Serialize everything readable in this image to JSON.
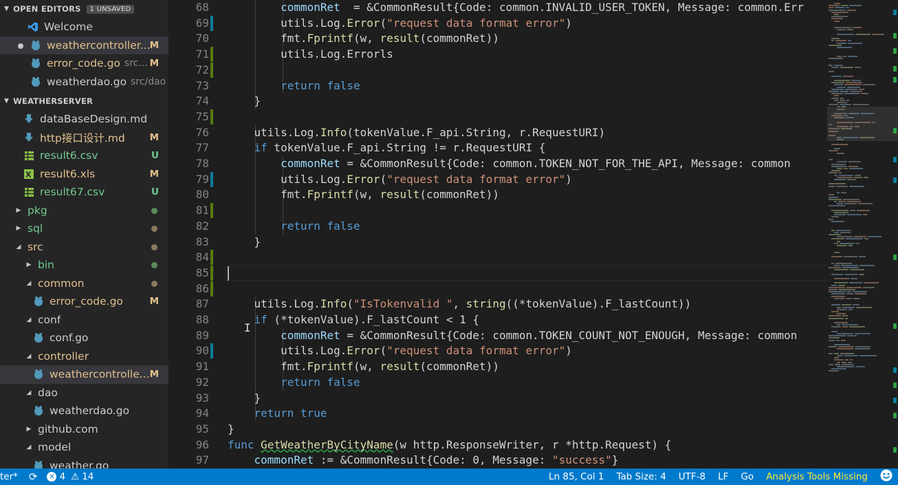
{
  "sidebar": {
    "open_editors": {
      "title": "OPEN EDITORS",
      "badge": "1 UNSAVED",
      "items": [
        {
          "name": "Welcome",
          "hint": "",
          "status": ""
        },
        {
          "name": "weathercontroller...",
          "hint": "",
          "status": "M"
        },
        {
          "name": "error_code.go",
          "hint": "src...",
          "status": "M"
        },
        {
          "name": "weatherdao.go",
          "hint": "src/dao",
          "status": ""
        }
      ]
    },
    "explorer": {
      "title": "WEATHERSERVER",
      "items": [
        {
          "name": "dataBaseDesign.md",
          "status": ""
        },
        {
          "name": "http接口设计.md",
          "status": "M"
        },
        {
          "name": "result6.csv",
          "status": "U"
        },
        {
          "name": "result6.xls",
          "status": "M"
        },
        {
          "name": "result67.csv",
          "status": "U"
        },
        {
          "name": "pkg",
          "status": ""
        },
        {
          "name": "sql",
          "status": ""
        },
        {
          "name": "src",
          "status": ""
        },
        {
          "name": "bin",
          "status": ""
        },
        {
          "name": "common",
          "status": ""
        },
        {
          "name": "error_code.go",
          "status": "M"
        },
        {
          "name": "conf",
          "status": ""
        },
        {
          "name": "conf.go",
          "status": ""
        },
        {
          "name": "controller",
          "status": ""
        },
        {
          "name": "weathercontrolle...",
          "status": "M"
        },
        {
          "name": "dao",
          "status": ""
        },
        {
          "name": "weatherdao.go",
          "status": ""
        },
        {
          "name": "github.com",
          "status": ""
        },
        {
          "name": "model",
          "status": ""
        },
        {
          "name": "weather.go",
          "status": ""
        }
      ]
    }
  },
  "editor": {
    "line_numbers": [
      "68",
      "69",
      "70",
      "71",
      "72",
      "73",
      "74",
      "75",
      "76",
      "77",
      "78",
      "79",
      "80",
      "81",
      "82",
      "83",
      "84",
      "85",
      "86",
      "87",
      "88",
      "89",
      "90",
      "91",
      "92",
      "93",
      "94",
      "95",
      "96",
      "97"
    ],
    "lines": [
      [
        [
          "v",
          "        commonRet"
        ],
        [
          "",
          "  = &CommonResult{Code: common.INVALID_USER_TOKEN, Message: common.Err"
        ]
      ],
      [
        [
          "",
          "        utils.Log."
        ],
        [
          "f",
          "Error"
        ],
        [
          "",
          "("
        ],
        [
          "s",
          "\"request data format error\""
        ],
        [
          "",
          ")"
        ]
      ],
      [
        [
          "",
          "        fmt."
        ],
        [
          "f",
          "Fprintf"
        ],
        [
          "",
          "(w, "
        ],
        [
          "f",
          "result"
        ],
        [
          "",
          "(commonRet))"
        ]
      ],
      [
        [
          "",
          "        utils.Log.Errorls"
        ]
      ],
      [
        [
          "",
          ""
        ]
      ],
      [
        [
          "k",
          "        return false"
        ]
      ],
      [
        [
          "",
          "    }"
        ]
      ],
      [
        [
          "",
          ""
        ]
      ],
      [
        [
          "",
          "    utils.Log."
        ],
        [
          "f",
          "Info"
        ],
        [
          "",
          "(tokenValue.F_api.String, r.RequestURI)"
        ]
      ],
      [
        [
          "k",
          "    if"
        ],
        [
          "",
          " tokenValue.F_api.String != r.RequestURI {"
        ]
      ],
      [
        [
          "v",
          "        commonRet"
        ],
        [
          "",
          " = &CommonResult{Code: common.TOKEN_NOT_FOR_THE_API, Message: common"
        ]
      ],
      [
        [
          "",
          "        utils.Log."
        ],
        [
          "f",
          "Error"
        ],
        [
          "",
          "("
        ],
        [
          "s",
          "\"request data format error\""
        ],
        [
          "",
          ")"
        ]
      ],
      [
        [
          "",
          "        fmt."
        ],
        [
          "f",
          "Fprintf"
        ],
        [
          "",
          "(w, "
        ],
        [
          "f",
          "result"
        ],
        [
          "",
          "(commonRet))"
        ]
      ],
      [
        [
          "",
          ""
        ]
      ],
      [
        [
          "k",
          "        return false"
        ]
      ],
      [
        [
          "",
          "    }"
        ]
      ],
      [
        [
          "",
          ""
        ]
      ],
      [
        [
          "",
          ""
        ]
      ],
      [
        [
          "",
          ""
        ]
      ],
      [
        [
          "",
          "    utils.Log."
        ],
        [
          "f",
          "Info"
        ],
        [
          "",
          "("
        ],
        [
          "s",
          "\"IsTokenvalid \""
        ],
        [
          "",
          ", "
        ],
        [
          "f",
          "string"
        ],
        [
          "",
          "((*tokenValue).F_lastCount))"
        ]
      ],
      [
        [
          "k",
          "    if"
        ],
        [
          "",
          " (*tokenValue).F_lastCount < 1 {"
        ]
      ],
      [
        [
          "v",
          "        commonRet"
        ],
        [
          "",
          " = &CommonResult{Code: common.TOKEN_COUNT_NOT_ENOUGH, Message: common"
        ]
      ],
      [
        [
          "",
          "        utils.Log."
        ],
        [
          "f",
          "Error"
        ],
        [
          "",
          "("
        ],
        [
          "s",
          "\"request data format error\""
        ],
        [
          "",
          ")"
        ]
      ],
      [
        [
          "",
          "        fmt."
        ],
        [
          "f",
          "Fprintf"
        ],
        [
          "",
          "(w, "
        ],
        [
          "f",
          "result"
        ],
        [
          "",
          "(commonRet))"
        ]
      ],
      [
        [
          "k",
          "        return false"
        ]
      ],
      [
        [
          "",
          "    }"
        ]
      ],
      [
        [
          "k",
          "    return true"
        ]
      ],
      [
        [
          "",
          "}"
        ]
      ],
      [
        [
          "k",
          "func"
        ],
        [
          "",
          " "
        ],
        [
          "f",
          "GetWeatherByCityName"
        ],
        [
          "",
          "(w http.ResponseWriter, r *http.Request) {"
        ]
      ],
      [
        [
          "v",
          "    commonRet"
        ],
        [
          "",
          " := &CommonResult{Code: 0, Message: "
        ],
        [
          "s",
          "\"success\""
        ],
        [
          "",
          "}"
        ]
      ]
    ]
  },
  "statusbar": {
    "branch": "ter*",
    "errors": "4",
    "warnings": "14",
    "position": "Ln 85, Col 1",
    "tab_size": "Tab Size: 4",
    "encoding": "UTF-8",
    "eol": "LF",
    "language": "Go",
    "analysis": "Analysis Tools Missing"
  },
  "colors": {
    "accent": "#007acc",
    "modified": "#e2c08d",
    "untracked": "#73c991",
    "git_added": "#587c0c",
    "git_modified": "#0c7d9d"
  }
}
